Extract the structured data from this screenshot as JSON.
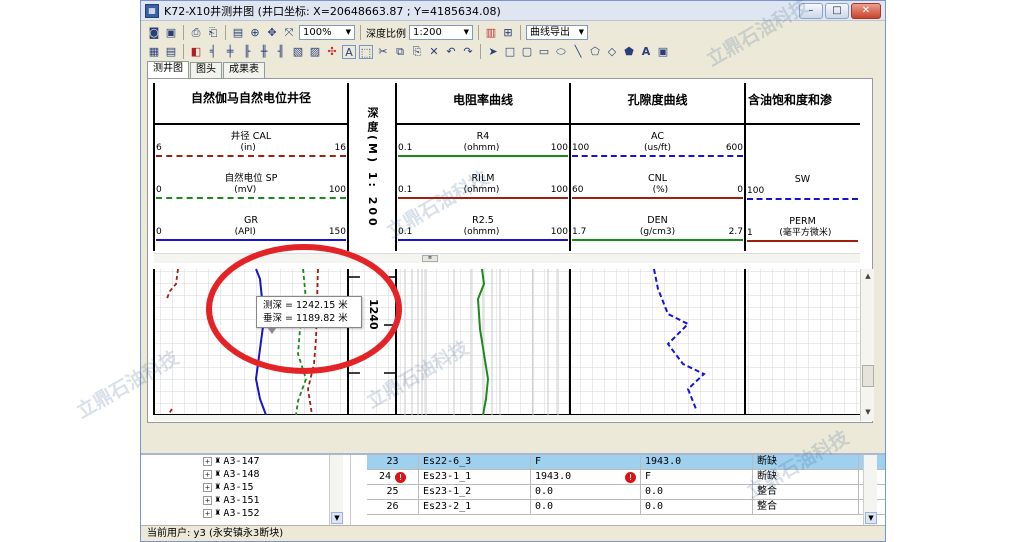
{
  "window": {
    "title": "K72-X10井测井图 (井口坐标: X=20648663.87 ; Y=4185634.08)",
    "icon": "app-icon",
    "controls": [
      "minimize-icon",
      "maximize-icon",
      "close-icon"
    ]
  },
  "toolbar1": {
    "zoom": "100%",
    "depth_scale_label": "深度比例",
    "depth_scale_value": "1:200",
    "export_label": "曲线导出"
  },
  "tabs": [
    "测井图",
    "图头",
    "成果表"
  ],
  "tracks": {
    "track1_title": "自然伽马自然电位井径",
    "depth_title": "深度(M) 1: 200",
    "track2_title": "电阻率曲线",
    "track3_title": "孔隙度曲线",
    "track4_title": "含油饱和度和渗"
  },
  "curves": {
    "t1": [
      {
        "name": "井径 CAL",
        "unit": "(in)",
        "min": "6",
        "max": "16",
        "color": "#a02010"
      },
      {
        "name": "自然电位 SP",
        "unit": "(mV)",
        "min": "0",
        "max": "100",
        "color": "#1a8a1a"
      },
      {
        "name": "GR",
        "unit": "(API)",
        "min": "0",
        "max": "150",
        "color": "#1515d0"
      }
    ],
    "t2": [
      {
        "name": "R4",
        "unit": "(ohmm)",
        "min": "0.1",
        "max": "100",
        "color": "#1a8a1a"
      },
      {
        "name": "RILM",
        "unit": "(ohmm)",
        "min": "0.1",
        "max": "100",
        "color": "#a02010"
      },
      {
        "name": "R2.5",
        "unit": "(ohmm)",
        "min": "0.1",
        "max": "100",
        "color": "#1515d0"
      }
    ],
    "t3": [
      {
        "name": "AC",
        "unit": "(us/ft)",
        "min": "100",
        "max": "600",
        "color": "#1515d0"
      },
      {
        "name": "CNL",
        "unit": "(%)",
        "min": "60",
        "max": "0",
        "color": "#a02010"
      },
      {
        "name": "DEN",
        "unit": "(g/cm3)",
        "min": "1.7",
        "max": "2.7",
        "color": "#1a8a1a"
      }
    ],
    "t4": [
      {
        "name": "SW",
        "unit": "",
        "min": "100",
        "max": "",
        "color": "#1515d0"
      },
      {
        "name": "PERM",
        "unit": "(毫平方微米)",
        "min": "1",
        "max": "",
        "color": "#a02010"
      }
    ]
  },
  "depth_tick": "1240",
  "tooltip": {
    "line1": "测深 = 1242.15 米",
    "line2": "垂深 = 1189.82 米"
  },
  "tree": [
    "A3-147",
    "A3-148",
    "A3-15",
    "A3-151",
    "A3-152"
  ],
  "grid": [
    {
      "n": "23",
      "c1": "Es22-6_3",
      "c2": "F",
      "c3": "1943.0",
      "c4": "断缺",
      "selected": true,
      "err_left": false,
      "err_mid": false
    },
    {
      "n": "24",
      "c1": "Es23-1_1",
      "c2": "1943.0",
      "c3": "F",
      "c4": "断缺",
      "selected": false,
      "err_left": true,
      "err_mid": true
    },
    {
      "n": "25",
      "c1": "Es23-1_2",
      "c2": "0.0",
      "c3": "0.0",
      "c4": "整合",
      "selected": false,
      "err_left": false,
      "err_mid": false
    },
    {
      "n": "26",
      "c1": "Es23-2_1",
      "c2": "0.0",
      "c3": "0.0",
      "c4": "整合",
      "selected": false,
      "err_left": false,
      "err_mid": false
    }
  ],
  "status": "当前用户:  y3 (永安镇永3断块)",
  "watermark": "立鼎石油科技",
  "colors": {
    "annotation": "#e32326",
    "selected_row": "#9fd0ee",
    "titlebar": "#dfe6f1"
  }
}
